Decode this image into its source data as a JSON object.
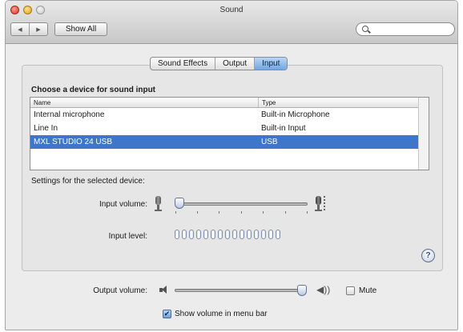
{
  "window": {
    "title": "Sound"
  },
  "toolbar": {
    "back_glyph": "◀",
    "forward_glyph": "▶",
    "show_all_label": "Show All",
    "search_value": ""
  },
  "tabs": [
    {
      "label": "Sound Effects",
      "active": false
    },
    {
      "label": "Output",
      "active": false
    },
    {
      "label": "Input",
      "active": true
    }
  ],
  "device_section": {
    "title": "Choose a device for sound input",
    "columns": [
      "Name",
      "Type"
    ],
    "rows": [
      {
        "name": "Internal microphone",
        "type": "Built-in Microphone",
        "selected": false
      },
      {
        "name": "Line In",
        "type": "Built-in Input",
        "selected": false
      },
      {
        "name": "MXL STUDIO 24 USB",
        "type": "USB",
        "selected": true
      }
    ]
  },
  "settings": {
    "label": "Settings for the selected device:",
    "input_volume_label": "Input volume:",
    "input_volume_level": 0.0,
    "input_level_label": "Input level:",
    "input_level_active_segments": 0,
    "input_level_segment_count": 15
  },
  "help": {
    "glyph": "?"
  },
  "output": {
    "volume_label": "Output volume:",
    "volume_level": 0.95,
    "loud_glyph": "◀))",
    "mute_label": "Mute",
    "mute_checked": false,
    "menu_bar_label": "Show volume in menu bar",
    "menu_bar_checked": true,
    "check_glyph": "✔"
  },
  "colors": {
    "selection": "#3f76c9",
    "active_tab": "#6fa6e3",
    "close_button": "#d8352b",
    "minimize_button": "#e0a21c"
  }
}
